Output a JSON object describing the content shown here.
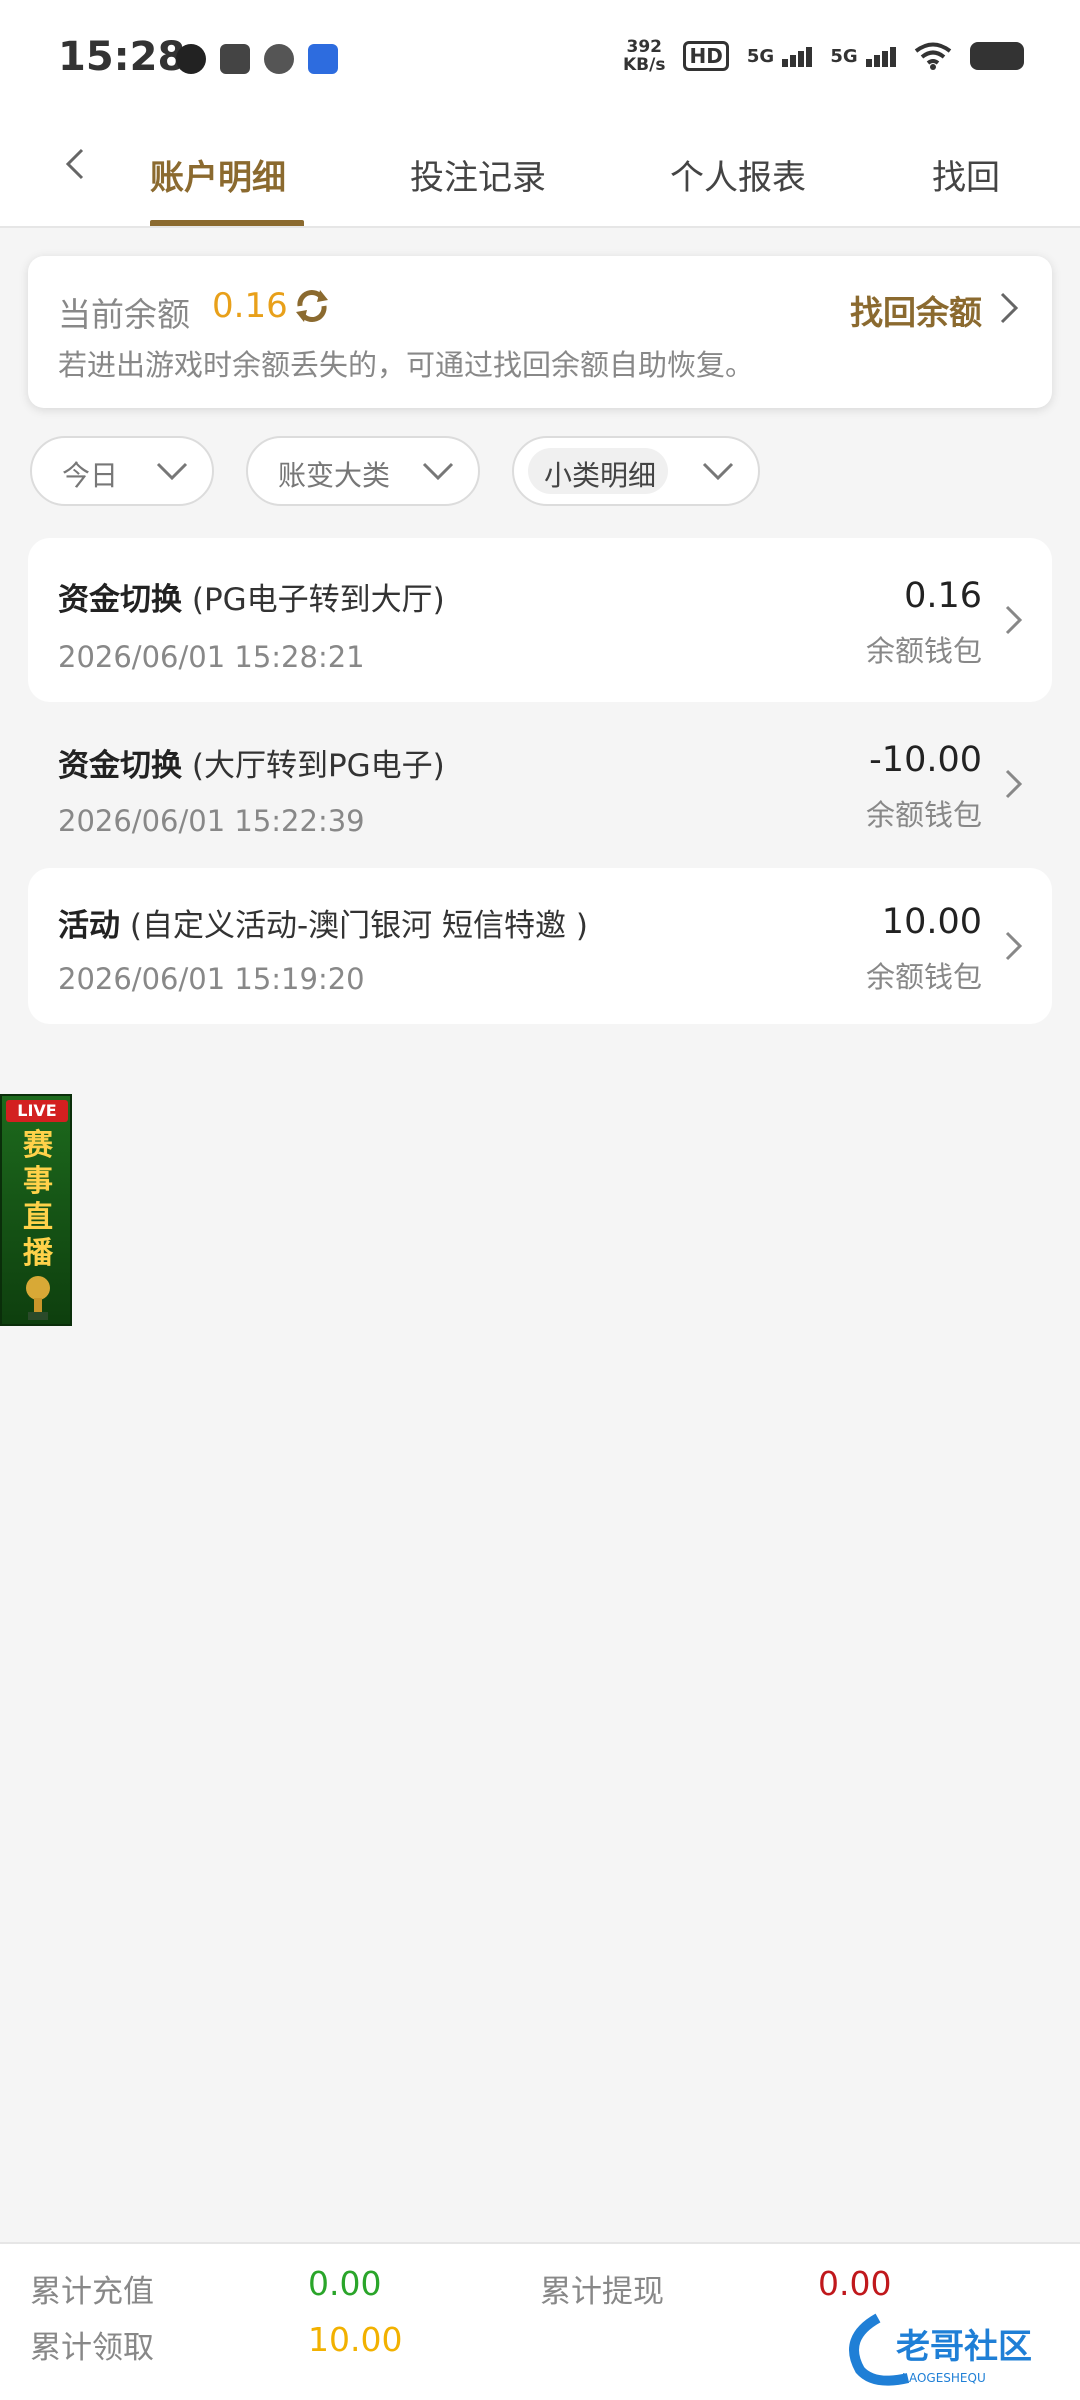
{
  "status_bar": {
    "time": "15:28",
    "net_speed_top": "392",
    "net_speed_unit": "KB/s",
    "hd_label": "HD",
    "signal_1": "5G",
    "signal_2": "5G"
  },
  "tabs": [
    {
      "label": "账户明细",
      "active": true
    },
    {
      "label": "投注记录",
      "active": false
    },
    {
      "label": "个人报表",
      "active": false
    },
    {
      "label": "找回",
      "active": false
    }
  ],
  "balance": {
    "label": "当前余额",
    "value": "0.16",
    "hint": "若进出游戏时余额丢失的，可通过找回余额自助恢复。",
    "recover_label": "找回余额"
  },
  "filters": [
    {
      "label": "今日"
    },
    {
      "label": "账变大类"
    },
    {
      "label": "小类明细"
    }
  ],
  "records": [
    {
      "type": "资金切换",
      "detail": "(PG电子转到大厅)",
      "time": "2026/06/01 15:28:21",
      "amount": "0.16",
      "wallet": "余额钱包"
    },
    {
      "type": "资金切换",
      "detail": "(大厅转到PG电子)",
      "time": "2026/06/01 15:22:39",
      "amount": "-10.00",
      "wallet": "余额钱包"
    },
    {
      "type": "活动",
      "detail": "(自定义活动-澳门银河 短信特邀 )",
      "time": "2026/06/01 15:19:20",
      "amount": "10.00",
      "wallet": "余额钱包"
    }
  ],
  "live_banner": {
    "tag": "LIVE",
    "text": "赛事直播"
  },
  "summary": {
    "total_deposit_label": "累计充值",
    "total_deposit_value": "0.00",
    "total_withdraw_label": "累计提现",
    "total_withdraw_value": "0.00",
    "total_claim_label": "累计领取",
    "total_claim_value": "10.00"
  },
  "watermark": {
    "text": "老哥社区",
    "sub": "LAOGESHEQU"
  },
  "colors": {
    "accent": "#8b6a2f",
    "balance": "#e8a01a",
    "deposit": "#2aa52a",
    "withdraw": "#c0181c",
    "claim": "#f2b100"
  }
}
